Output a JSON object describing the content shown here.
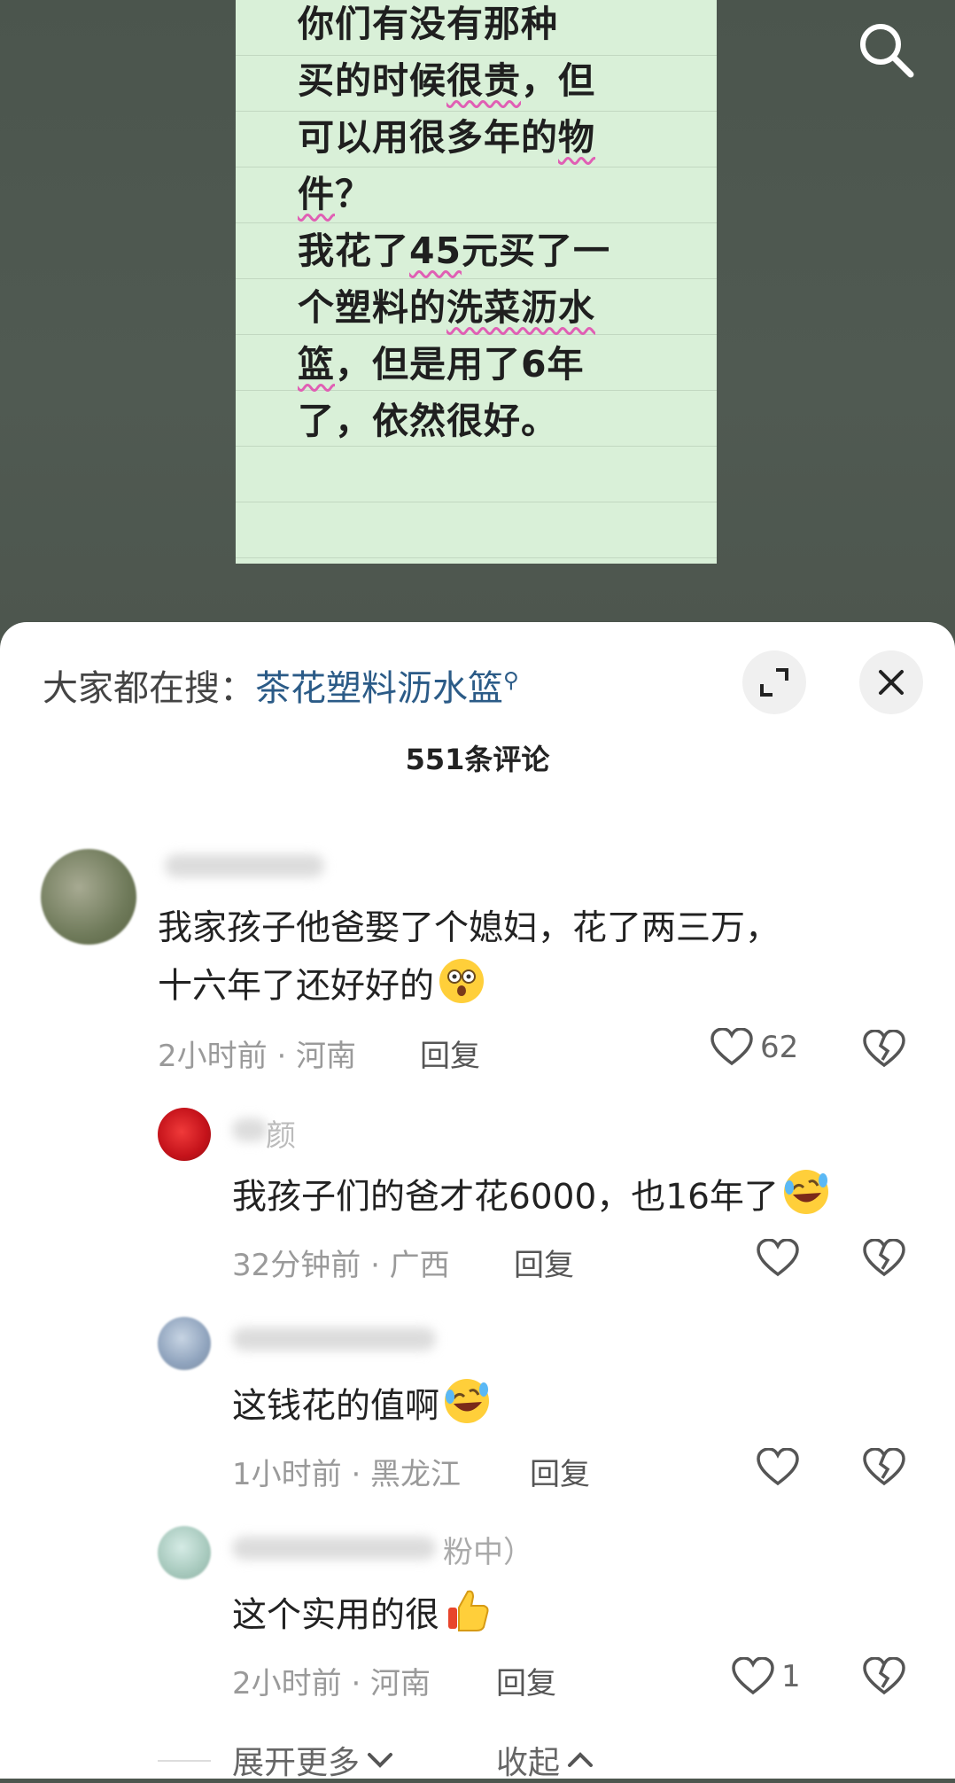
{
  "note": {
    "lines": [
      "你们有没有那种",
      "买的时候很贵，但",
      "可以用很多年的物",
      "件？",
      "我花了45元买了一",
      "个塑料的洗菜沥水",
      "篮，但是用了6年",
      "了，依然很好。"
    ]
  },
  "top_bar": {
    "search_icon": "search-icon"
  },
  "sheet": {
    "hot_search_prefix": "大家都在搜：",
    "hot_search_term": "茶花塑料沥水篮",
    "expand_icon": "expand-icon",
    "close_icon": "close-icon",
    "comment_count": "551条评论"
  },
  "comments": [
    {
      "text_line1": "我家孩子他爸娶了个媳妇，花了两三万，",
      "text_line2": "十六年了还好好的",
      "emoji": "astonished-face-emoji",
      "time": "2小时前 · 河南",
      "reply": "回复",
      "likes": "62"
    },
    {
      "name_fragment": "颜",
      "text": "我孩子们的爸才花6000，也16年了",
      "emoji": "rolling-laughing-emoji",
      "time": "32分钟前 · 广西",
      "reply": "回复",
      "likes": ""
    },
    {
      "text": "这钱花的值啊",
      "emoji": "rolling-laughing-emoji",
      "time": "1小时前 · 黑龙江",
      "reply": "回复",
      "likes": ""
    },
    {
      "fan_tag": "粉中）",
      "text": "这个实用的很",
      "emoji": "thumbs-up-emoji",
      "time": "2小时前 · 河南",
      "reply": "回复",
      "likes": "1"
    }
  ],
  "footer": {
    "expand_more": "展开更多",
    "collapse": "收起"
  },
  "colors": {
    "background": "#4d564e",
    "note": "#d9f0d8",
    "squiggle": "#e05fb4",
    "link": "#2b5b87"
  }
}
